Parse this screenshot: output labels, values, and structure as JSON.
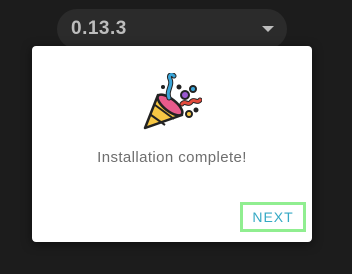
{
  "version_select": {
    "value": "0.13.3"
  },
  "dialog": {
    "message": "Installation complete!",
    "next_label": "NEXT",
    "icon": "party-popper-icon"
  },
  "colors": {
    "background": "#1c1c1c",
    "select_background": "#2b2b2b",
    "dialog_background": "#ffffff",
    "button_text": "#35a9c4",
    "button_focus_border": "#90ee90"
  }
}
